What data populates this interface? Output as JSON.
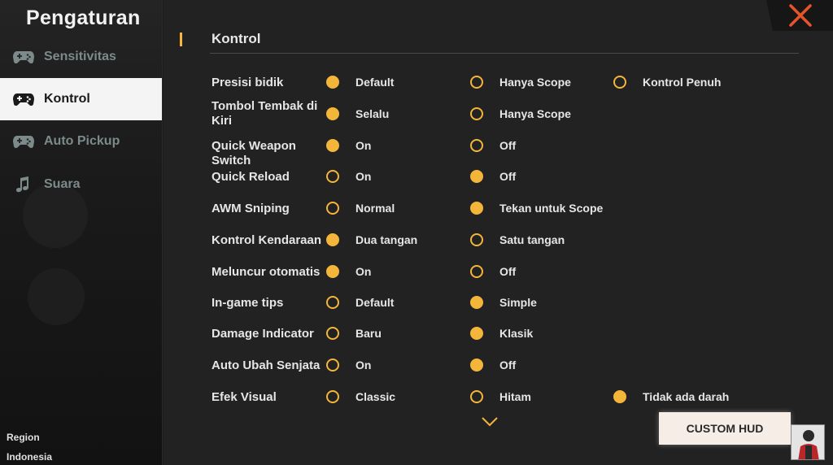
{
  "sidebar": {
    "title": "Pengaturan",
    "items": [
      {
        "label": "Sensitivitas",
        "icon": "gamepad-icon"
      },
      {
        "label": "Kontrol",
        "icon": "gamepad-icon"
      },
      {
        "label": "Auto Pickup",
        "icon": "gamepad-icon"
      },
      {
        "label": "Suara",
        "icon": "music-note-icon"
      }
    ],
    "active_index": 1,
    "region_label": "Region",
    "region_value": "Indonesia"
  },
  "main": {
    "section_title": "Kontrol",
    "rows": [
      {
        "label": "Presisi bidik",
        "options": [
          {
            "label": "Default",
            "selected": true
          },
          {
            "label": "Hanya Scope",
            "selected": false
          },
          {
            "label": "Kontrol Penuh",
            "selected": false
          }
        ]
      },
      {
        "label": "Tombol Tembak di Kiri",
        "options": [
          {
            "label": "Selalu",
            "selected": true
          },
          {
            "label": "Hanya Scope",
            "selected": false
          }
        ]
      },
      {
        "label": "Quick Weapon Switch",
        "options": [
          {
            "label": "On",
            "selected": true
          },
          {
            "label": "Off",
            "selected": false
          }
        ]
      },
      {
        "label": "Quick Reload",
        "options": [
          {
            "label": "On",
            "selected": false
          },
          {
            "label": "Off",
            "selected": true
          }
        ]
      },
      {
        "label": "AWM Sniping",
        "options": [
          {
            "label": "Normal",
            "selected": false
          },
          {
            "label": "Tekan untuk Scope",
            "selected": true
          }
        ]
      },
      {
        "label": "Kontrol Kendaraan",
        "options": [
          {
            "label": "Dua tangan",
            "selected": true
          },
          {
            "label": "Satu tangan",
            "selected": false
          }
        ]
      },
      {
        "label": "Meluncur otomatis",
        "options": [
          {
            "label": "On",
            "selected": true
          },
          {
            "label": "Off",
            "selected": false
          }
        ]
      },
      {
        "label": "In-game tips",
        "options": [
          {
            "label": "Default",
            "selected": false
          },
          {
            "label": "Simple",
            "selected": true
          }
        ]
      },
      {
        "label": "Damage Indicator",
        "options": [
          {
            "label": "Baru",
            "selected": false
          },
          {
            "label": "Klasik",
            "selected": true
          }
        ]
      },
      {
        "label": "Auto Ubah Senjata",
        "options": [
          {
            "label": "On",
            "selected": false
          },
          {
            "label": "Off",
            "selected": true
          }
        ]
      },
      {
        "label": "Efek Visual",
        "options": [
          {
            "label": "Classic",
            "selected": false
          },
          {
            "label": "Hitam",
            "selected": false
          },
          {
            "label": "Tidak ada darah",
            "selected": true
          }
        ]
      }
    ],
    "custom_hud_label": "CUSTOM HUD"
  },
  "colors": {
    "accent": "#f4b63a",
    "close": "#e8542a",
    "background": "#222222",
    "sidebar_active": "#f4f4f4"
  },
  "icons": {
    "close": "close-icon",
    "scroll_down": "chevron-down-icon",
    "avatar": "avatar"
  }
}
